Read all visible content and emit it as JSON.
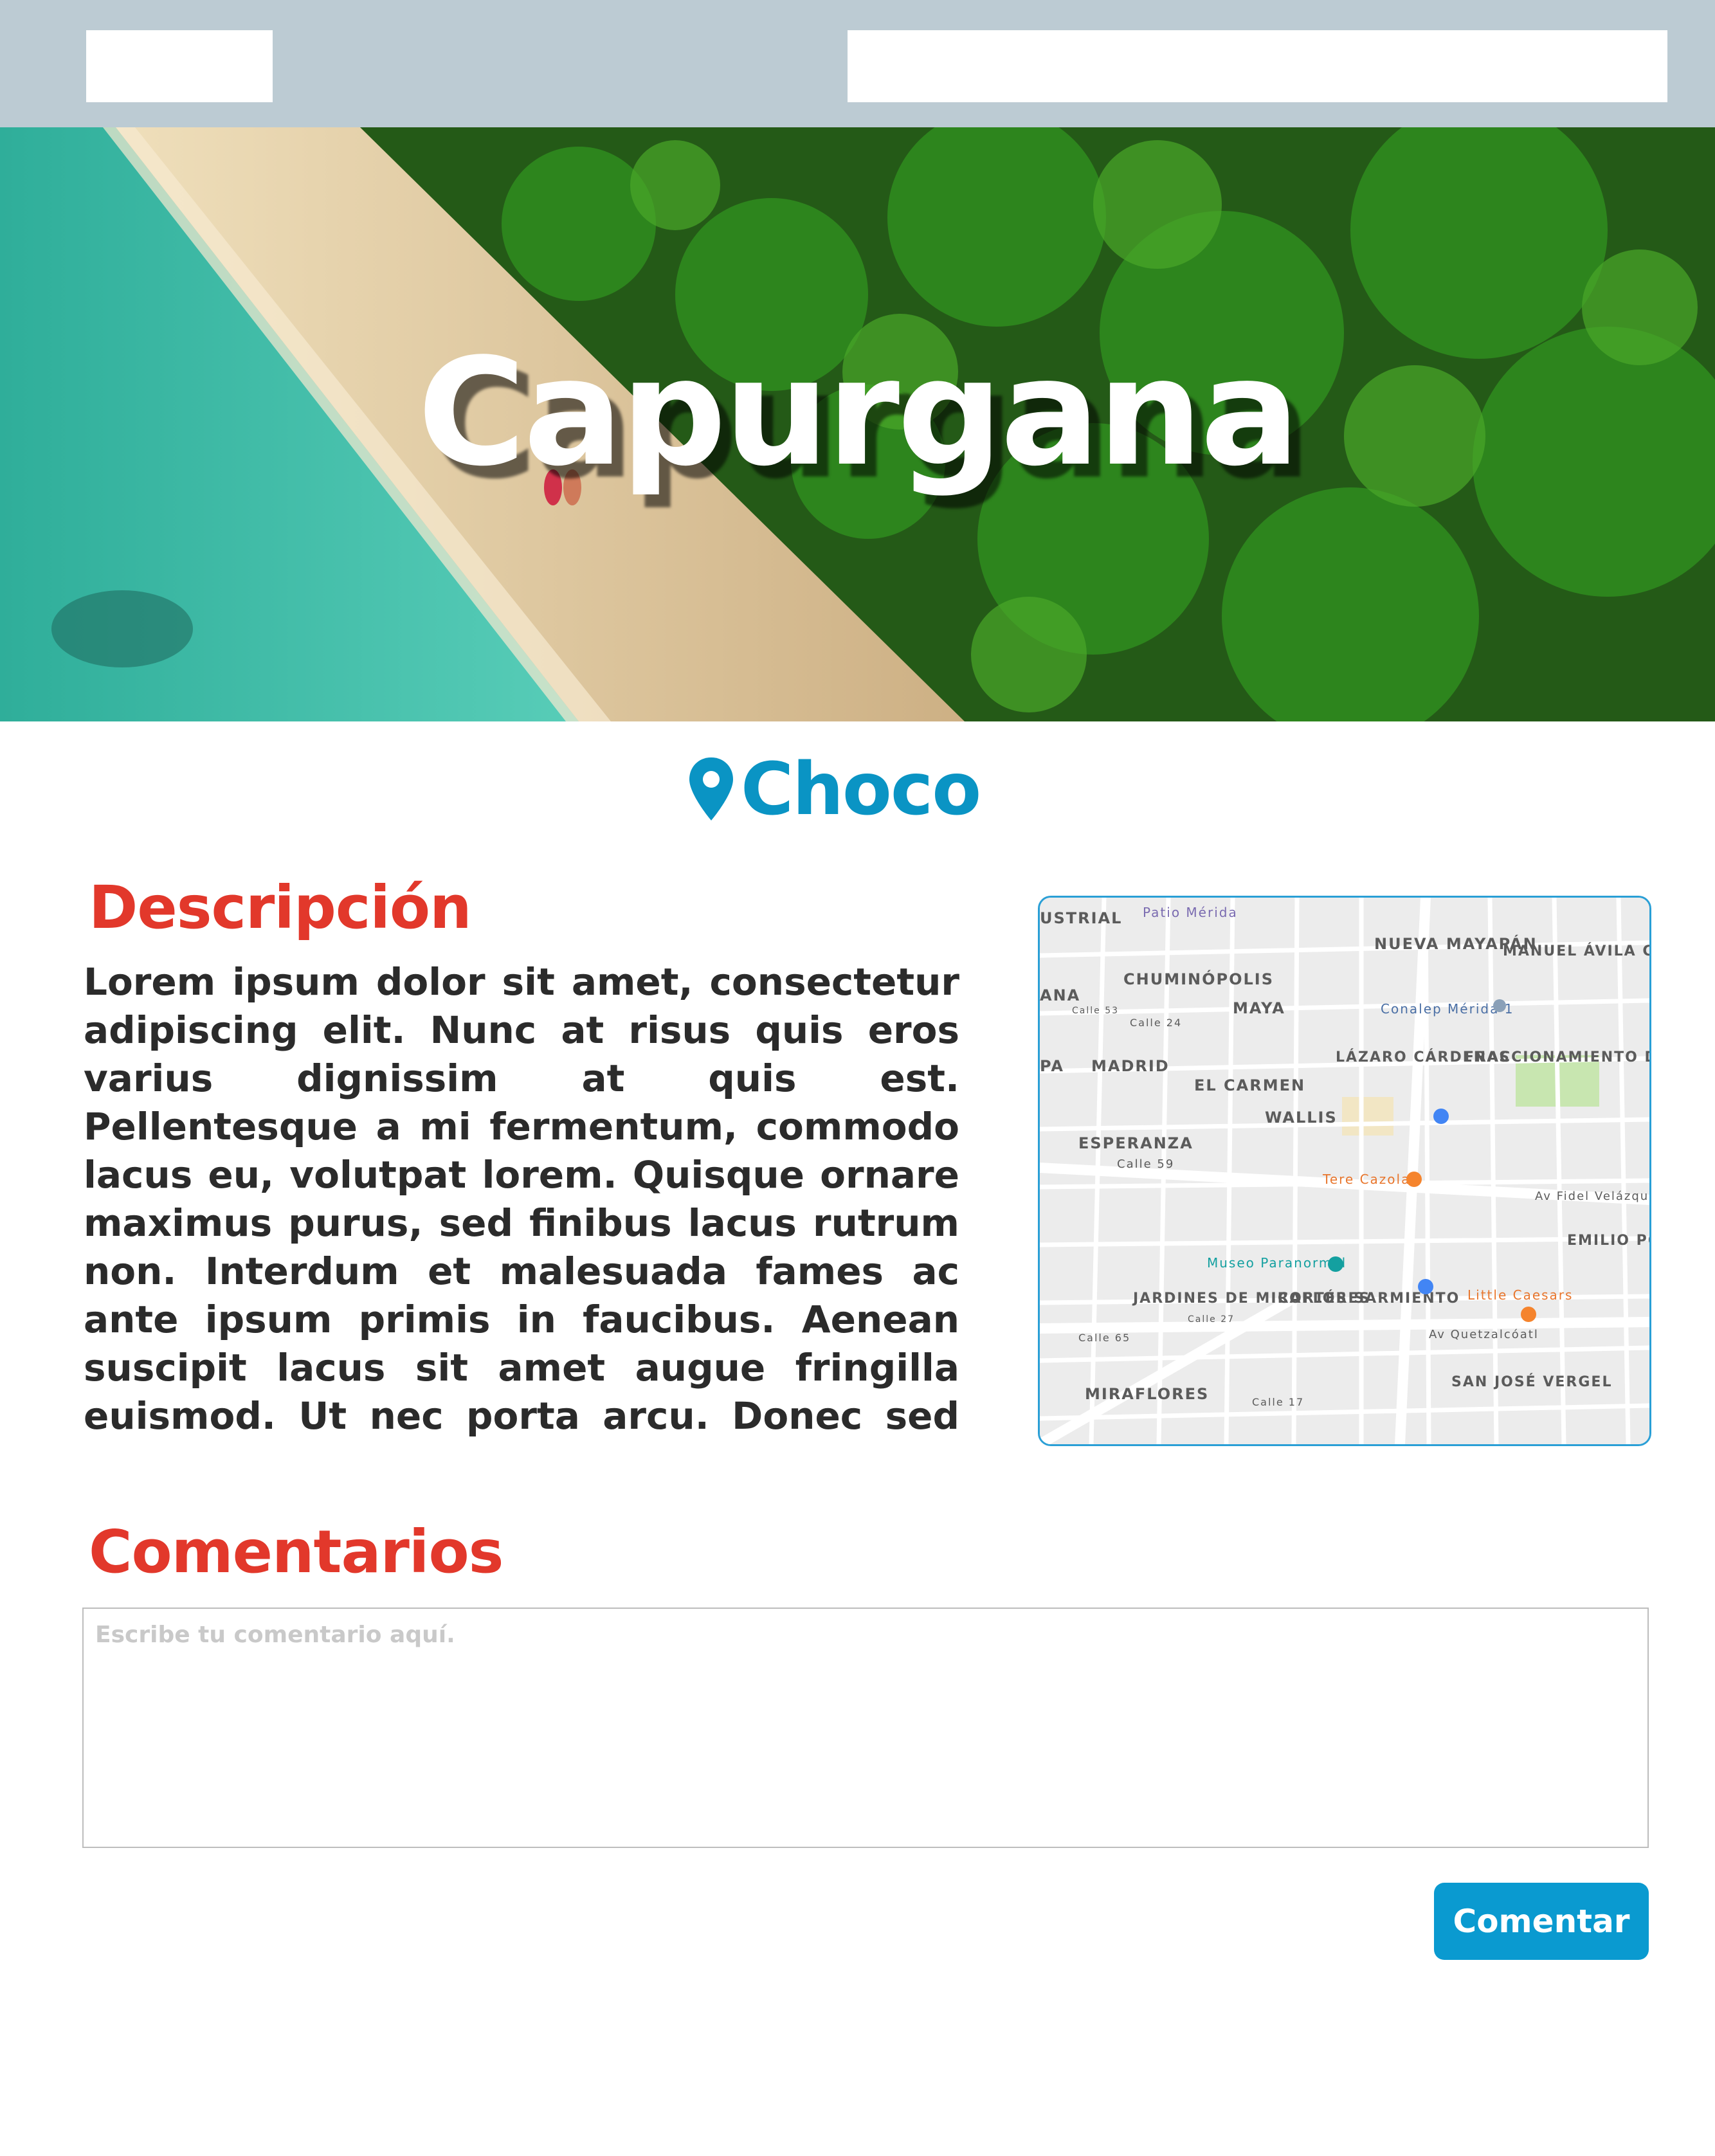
{
  "header": {
    "logo_placeholder": "",
    "search_value": ""
  },
  "hero": {
    "title": "Capurgana"
  },
  "location": {
    "icon": "map-pin-icon",
    "name": "Choco"
  },
  "description": {
    "title": "Descripción",
    "text": " Lorem ipsum dolor sit amet, consectetur adipiscing elit. Nunc at risus quis eros varius dignissim at quis est. Pellentesque a mi fermentum, commodo lacus eu, volutpat lorem. Quisque ornare maximus purus, sed finibus lacus rutrum non. Interdum et malesuada fames ac ante ipsum primis in faucibus. Aenean suscipit lacus sit amet augue fringilla euismod. Ut nec porta arcu. Donec sed ante id tellus"
  },
  "map": {
    "labels": {
      "patio_merida": "Patio Mérida",
      "nueva_mayapan": "NUEVA MAYAPÁN",
      "manuel_avila": "MANUEL ÁVILA CAMACHO II",
      "chuminopolis": "CHUMINÓPOLIS",
      "maya": "MAYA",
      "conalep": "Conalep Mérida 1",
      "madrid": "MADRID",
      "lazaro": "LÁZARO CÁRDENAS",
      "fraccionamiento": "FRACCIONAMIENTO DEL PARQUE",
      "el_carmen": "EL CARMEN",
      "wallis": "WALLIS",
      "esperanza": "ESPERANZA",
      "tere_cazola": "Tere Cazola",
      "av_fidel": "Av Fidel Velázquez",
      "museo": "Museo Paranormal",
      "emilio": "EMILIO PORTES GIL",
      "jardines": "JARDINES DE MIRAFLORES",
      "cortes": "CORTÉS SARMIENTO",
      "little_caesars": "Little Caesars",
      "av_quetzalcoatl": "Av Quetzalcóatl",
      "miraflores": "MIRAFLORES",
      "san_jose": "SAN JOSÉ VERGEL",
      "industrial": "USTRIAL",
      "ana": "ANA",
      "pa": "PA",
      "calle_59": "Calle 59",
      "calle_65": "Calle 65",
      "calle_17": "Calle 17",
      "calle_24": "Calle 24",
      "calle_53": "Calle 53",
      "calle_27": "Calle 27"
    },
    "colors": {
      "water_pin": "#4285f4",
      "food_pin": "#f5842d",
      "museum_pin": "#14a0a0",
      "park": "#c8e6b0"
    }
  },
  "comments": {
    "title": "Comentarios",
    "placeholder": "Escribe tu comentario aquí.",
    "submit_label": "Comentar"
  },
  "colors": {
    "topbar": "#bccbd3",
    "accent_red": "#e2382b",
    "accent_blue": "#0a94c4",
    "button": "#0a9ad0"
  }
}
